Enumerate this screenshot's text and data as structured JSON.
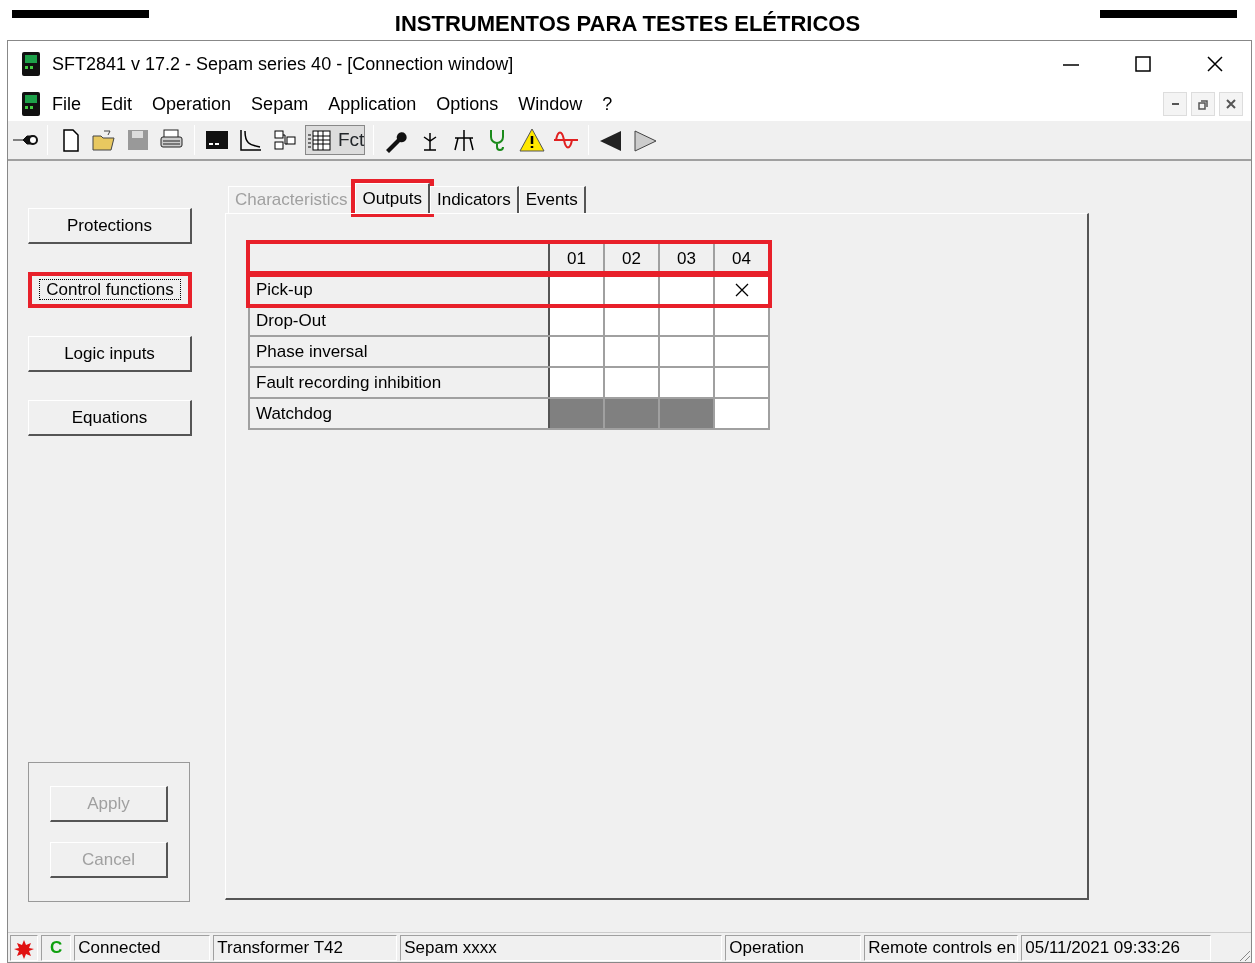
{
  "page_header": {
    "title": "INSTRUMENTOS PARA TESTES ELÉTRICOS"
  },
  "window": {
    "title": "SFT2841  v 17.2 - Sepam series 40 - [Connection window]"
  },
  "menu": [
    {
      "label": "File"
    },
    {
      "label": "Edit"
    },
    {
      "label": "Operation"
    },
    {
      "label": "Sepam"
    },
    {
      "label": "Application"
    },
    {
      "label": "Options"
    },
    {
      "label": "Window"
    },
    {
      "label": "?"
    }
  ],
  "toolbar": {
    "fct_button": {
      "label": "Fct",
      "pressed": true
    }
  },
  "sidebar": {
    "items": [
      {
        "label": "Protections",
        "selected": false,
        "highlighted": false
      },
      {
        "label": "Control functions",
        "selected": true,
        "highlighted": true
      },
      {
        "label": "Logic inputs",
        "selected": false,
        "highlighted": false
      },
      {
        "label": "Equations",
        "selected": false,
        "highlighted": false
      }
    ]
  },
  "tabs": [
    {
      "label": "Characteristics",
      "selected": false,
      "disabled": true,
      "highlighted": false
    },
    {
      "label": "Outputs",
      "selected": true,
      "disabled": false,
      "highlighted": true
    },
    {
      "label": "Indicators",
      "selected": false,
      "disabled": false,
      "highlighted": false
    },
    {
      "label": "Events",
      "selected": false,
      "disabled": false,
      "highlighted": false
    }
  ],
  "table": {
    "columns": [
      "01",
      "02",
      "03",
      "04"
    ],
    "rows": [
      {
        "label": "Pick-up",
        "highlighted": true,
        "cells": [
          {
            "checked": false,
            "disabled": false
          },
          {
            "checked": false,
            "disabled": false
          },
          {
            "checked": false,
            "disabled": false
          },
          {
            "checked": true,
            "disabled": false
          }
        ]
      },
      {
        "label": "Drop-Out",
        "highlighted": false,
        "cells": [
          {
            "checked": false,
            "disabled": false
          },
          {
            "checked": false,
            "disabled": false
          },
          {
            "checked": false,
            "disabled": false
          },
          {
            "checked": false,
            "disabled": false
          }
        ]
      },
      {
        "label": "Phase inversal",
        "highlighted": false,
        "cells": [
          {
            "checked": false,
            "disabled": false
          },
          {
            "checked": false,
            "disabled": false
          },
          {
            "checked": false,
            "disabled": false
          },
          {
            "checked": false,
            "disabled": false
          }
        ]
      },
      {
        "label": "Fault recording inhibition",
        "highlighted": false,
        "cells": [
          {
            "checked": false,
            "disabled": false
          },
          {
            "checked": false,
            "disabled": false
          },
          {
            "checked": false,
            "disabled": false
          },
          {
            "checked": false,
            "disabled": false
          }
        ]
      },
      {
        "label": "Watchdog",
        "highlighted": false,
        "cells": [
          {
            "checked": false,
            "disabled": true
          },
          {
            "checked": false,
            "disabled": true
          },
          {
            "checked": false,
            "disabled": true
          },
          {
            "checked": false,
            "disabled": false
          }
        ]
      }
    ]
  },
  "actions": [
    {
      "label": "Apply",
      "disabled": true
    },
    {
      "label": "Cancel",
      "disabled": true
    }
  ],
  "status_bar": {
    "refresh_symbol": "C",
    "fields": [
      "Connected",
      "Transformer T42",
      "Sepam xxxx",
      "Operation",
      "Remote controls en",
      "05/11/2021  09:33:26"
    ]
  }
}
